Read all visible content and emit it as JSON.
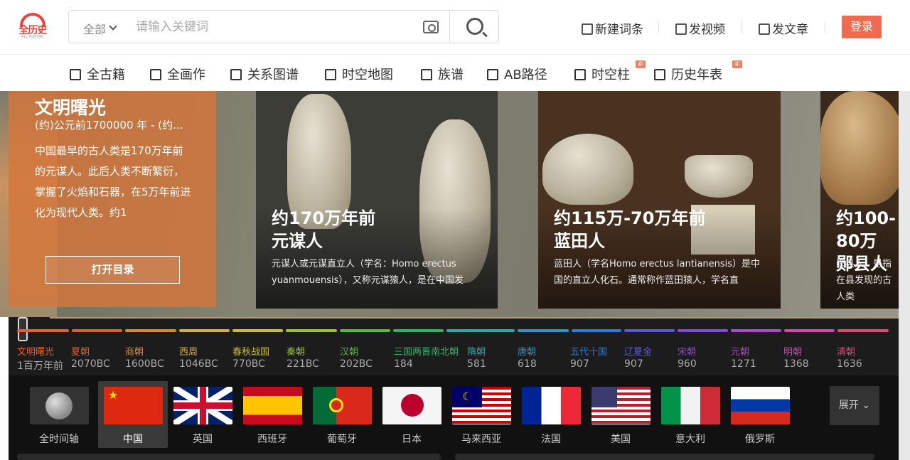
{
  "header": {
    "logo_text": "全历史",
    "logo_sub": "ALL HISTORY",
    "search": {
      "scope": "全部",
      "placeholder": "请输入关键词"
    },
    "links": [
      "新建词条",
      "发视频",
      "发文章"
    ],
    "login": "登录"
  },
  "nav": {
    "items": [
      "全古籍",
      "全画作",
      "关系图谱",
      "时空地图",
      "族谱",
      "AB路径",
      "时空柱",
      "历史年表"
    ],
    "new_badge": "新"
  },
  "hero": {
    "panel": {
      "title": "文明曙光",
      "date": "(约)公元前1700000 年 - (约...",
      "description": "中国最早的古人类是170万年前的元谋人。此后人类不断繁衍，掌握了火焰和石器，在5万年前进化为现代人类。约1",
      "button": "打开目录"
    },
    "cards": [
      {
        "time": "约170万年前",
        "name": "元谋人",
        "desc": "元谋人或元谋直立人（学名：Homo erectus yuanmouensis），又称元谋猿人，是在中国发"
      },
      {
        "time": "约115万-70万年前",
        "name": "蓝田人",
        "desc": "蓝田人（学名Homo erectus lantianensis）是中国的直立人化石。通常称作蓝田猿人，学名直"
      },
      {
        "time": "约100-80万",
        "name": "郧县人",
        "desc": "郧县人，是指在县发现的古人类"
      }
    ]
  },
  "timeline": {
    "periods": [
      {
        "name": "文明曙光",
        "year": "1百万年前",
        "color": "#e8612c"
      },
      {
        "name": "夏朝",
        "year": "2070BC",
        "color": "#d9622c"
      },
      {
        "name": "商朝",
        "year": "1600BC",
        "color": "#d78a2a"
      },
      {
        "name": "西周",
        "year": "1046BC",
        "color": "#d7b12a"
      },
      {
        "name": "春秋战国",
        "year": "770BC",
        "color": "#c9c22a"
      },
      {
        "name": "秦朝",
        "year": "221BC",
        "color": "#9cc22a"
      },
      {
        "name": "汉朝",
        "year": "202BC",
        "color": "#55b83a"
      },
      {
        "name": "三国两晋南北朝",
        "year": "184",
        "color": "#2fb36a"
      },
      {
        "name": "隋朝",
        "year": "581",
        "color": "#2aa8a2"
      },
      {
        "name": "唐朝",
        "year": "618",
        "color": "#2a95c8"
      },
      {
        "name": "五代十国",
        "year": "907",
        "color": "#2a7ad8"
      },
      {
        "name": "辽夏金",
        "year": "907",
        "color": "#5a58d8"
      },
      {
        "name": "宋朝",
        "year": "960",
        "color": "#8a48d8"
      },
      {
        "name": "元朝",
        "year": "1271",
        "color": "#b048c8"
      },
      {
        "name": "明朝",
        "year": "1368",
        "color": "#d048a8"
      },
      {
        "name": "清朝",
        "year": "1636",
        "color": "#e04878"
      }
    ]
  },
  "countries": {
    "items": [
      "全时间轴",
      "中国",
      "英国",
      "西班牙",
      "葡萄牙",
      "日本",
      "马来西亚",
      "法国",
      "美国",
      "意大利",
      "俄罗斯"
    ],
    "active": "中国",
    "expand": "展开"
  }
}
